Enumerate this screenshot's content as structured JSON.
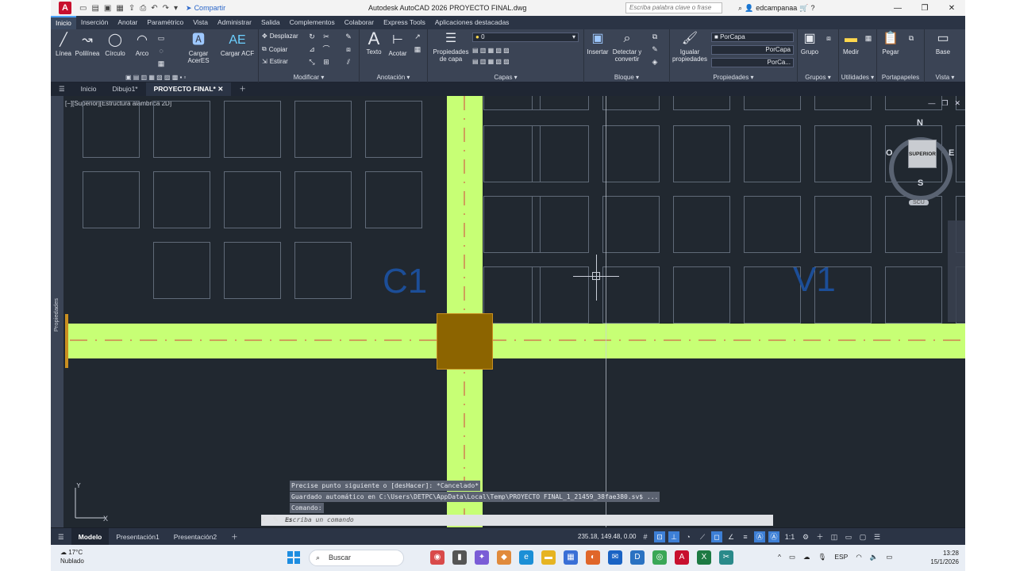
{
  "titlebar": {
    "app_logo": "A",
    "share": "Compartir",
    "title": "Autodesk AutoCAD 2026    PROYECTO FINAL.dwg",
    "search_placeholder": "Escriba palabra clave o frase",
    "user": "edcampanaa"
  },
  "menu_tabs": [
    "Inicio",
    "Inserción",
    "Anotar",
    "Paramétrico",
    "Vista",
    "Administrar",
    "Salida",
    "Complementos",
    "Colaborar",
    "Express Tools",
    "Aplicaciones destacadas"
  ],
  "ribbon": {
    "draw": {
      "linea": "Línea",
      "polilinea": "Polilínea",
      "circulo": "Círculo",
      "arco": "Arco",
      "cargar_acer": "Cargar AcerES",
      "cargar_acf": "Cargar ACF"
    },
    "modify": {
      "title": "Modificar",
      "desplazar": "Desplazar",
      "copiar": "Copiar",
      "estirar": "Estirar"
    },
    "annotation": {
      "title": "Anotación",
      "texto": "Texto",
      "acotar": "Acotar"
    },
    "layers": {
      "title": "Capas",
      "props": "Propiedades de capa",
      "current_layer": "0"
    },
    "block": {
      "title": "Bloque",
      "insertar": "Insertar",
      "detectar": "Detectar y convertir"
    },
    "properties": {
      "title": "Propiedades",
      "igualar": "Igualar propiedades",
      "color": "PorCapa",
      "linetype": "PorCapa",
      "lineweight": "PorCa..."
    },
    "groups": {
      "title": "Grupos",
      "grupo": "Grupo"
    },
    "utilities": {
      "title": "Utilidades",
      "medir": "Medir"
    },
    "clipboard": {
      "title": "Portapapeles",
      "pegar": "Pegar"
    },
    "view": {
      "title": "Vista",
      "base": "Base"
    }
  },
  "file_tabs": {
    "menu_icon": "hamburger-icon",
    "items": [
      "Inicio",
      "Dibujo1*",
      "PROYECTO FINAL*"
    ]
  },
  "viewport": {
    "label": "[−][Superior][Estructura alámbrica 2D]",
    "palette": "Propiedades",
    "tags": [
      "C1",
      "V1"
    ],
    "viewcube": {
      "n": "N",
      "s": "S",
      "e": "E",
      "w": "O",
      "face": "SUPERIOR",
      "ucs": "SCU"
    },
    "colors": {
      "beam": "#c7ff75",
      "column": "#8c6400",
      "tag": "#1c4e98",
      "axis": "#d64040"
    }
  },
  "command": {
    "history": [
      "Precise punto siguiente o [desHacer]: *Cancelado*",
      "Guardado automático en C:\\Users\\DETPC\\AppData\\Local\\Temp\\PROYECTO FINAL_1_21459_38fae380.sv$ ...",
      "Comando:"
    ],
    "placeholder": "Escriba un comando"
  },
  "statusbar": {
    "tabs": [
      "Modelo",
      "Presentación1",
      "Presentación2"
    ],
    "coords": "235.18, 149.48, 0.00",
    "scale": "1:1"
  },
  "taskbar": {
    "temp": "17°C",
    "weather": "Nublado",
    "search": "Buscar",
    "lang": "ESP",
    "time": "13:28",
    "date": "15/1/2026"
  }
}
